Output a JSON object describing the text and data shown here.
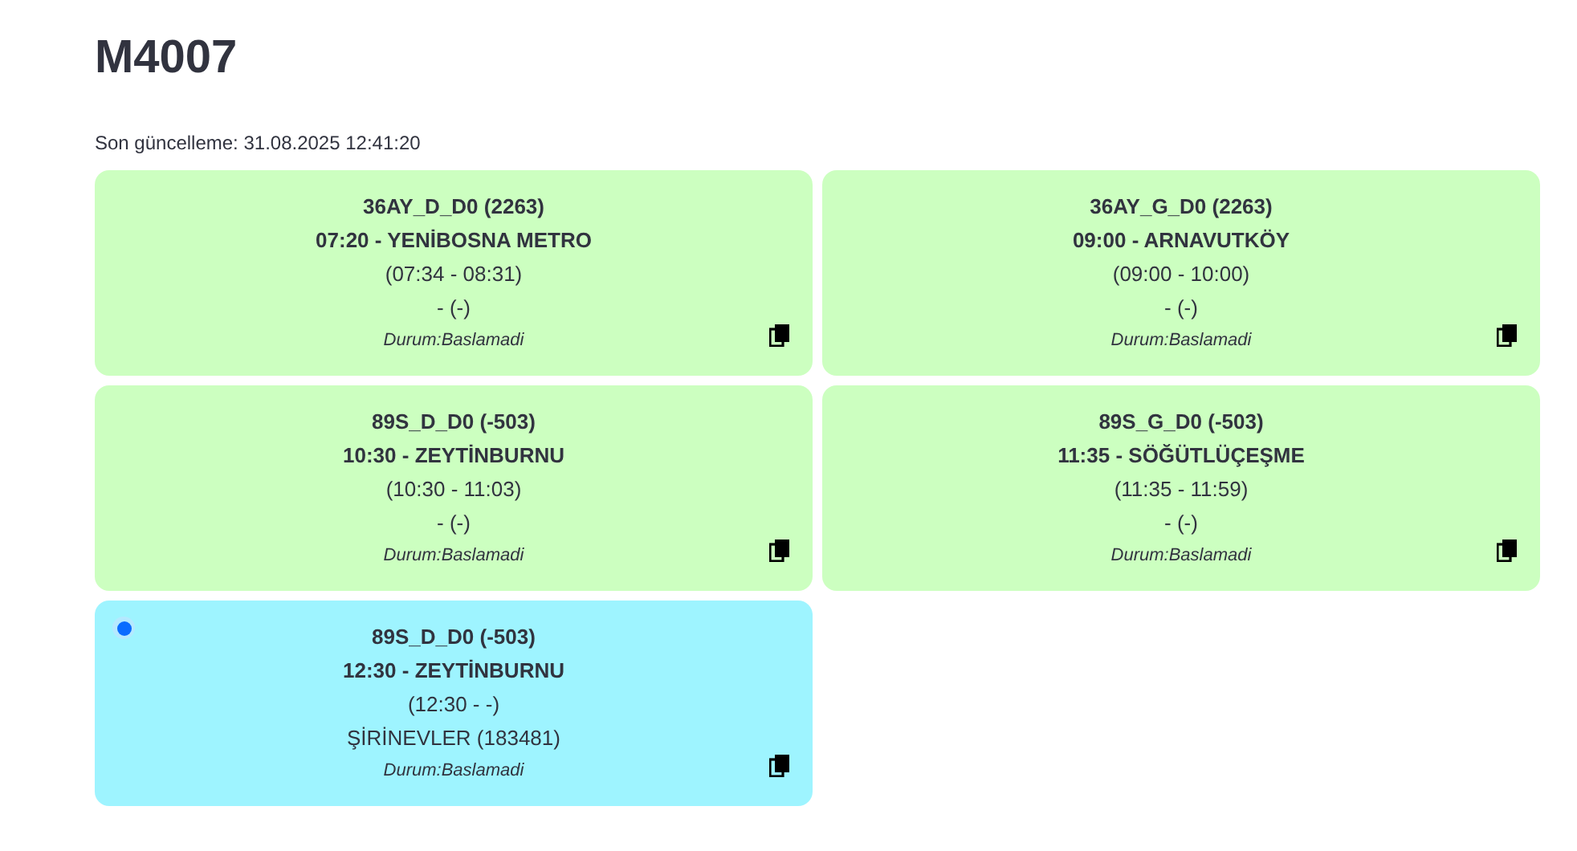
{
  "title": "M4007",
  "last_update": "Son güncelleme: 31.08.2025 12:41:20",
  "cards": [
    {
      "code": "36AY_D_D0 (2263)",
      "trip": "07:20 - YENİBOSNA METRO",
      "times": "(07:34 - 08:31)",
      "location": "- (-)",
      "status": "Durum:Baslamadi",
      "active": false
    },
    {
      "code": "36AY_G_D0 (2263)",
      "trip": "09:00 - ARNAVUTKÖY",
      "times": "(09:00 - 10:00)",
      "location": "- (-)",
      "status": "Durum:Baslamadi",
      "active": false
    },
    {
      "code": "89S_D_D0 (-503)",
      "trip": "10:30 - ZEYTİNBURNU",
      "times": "(10:30 - 11:03)",
      "location": "- (-)",
      "status": "Durum:Baslamadi",
      "active": false
    },
    {
      "code": "89S_G_D0 (-503)",
      "trip": "11:35 - SÖĞÜTLÜÇEŞME",
      "times": "(11:35 - 11:59)",
      "location": "- (-)",
      "status": "Durum:Baslamadi",
      "active": false
    },
    {
      "code": "89S_D_D0 (-503)",
      "trip": "12:30 - ZEYTİNBURNU",
      "times": "(12:30 - -)",
      "location": "ŞİRİNEVLER (183481)",
      "status": "Durum:Baslamadi",
      "active": true
    }
  ]
}
